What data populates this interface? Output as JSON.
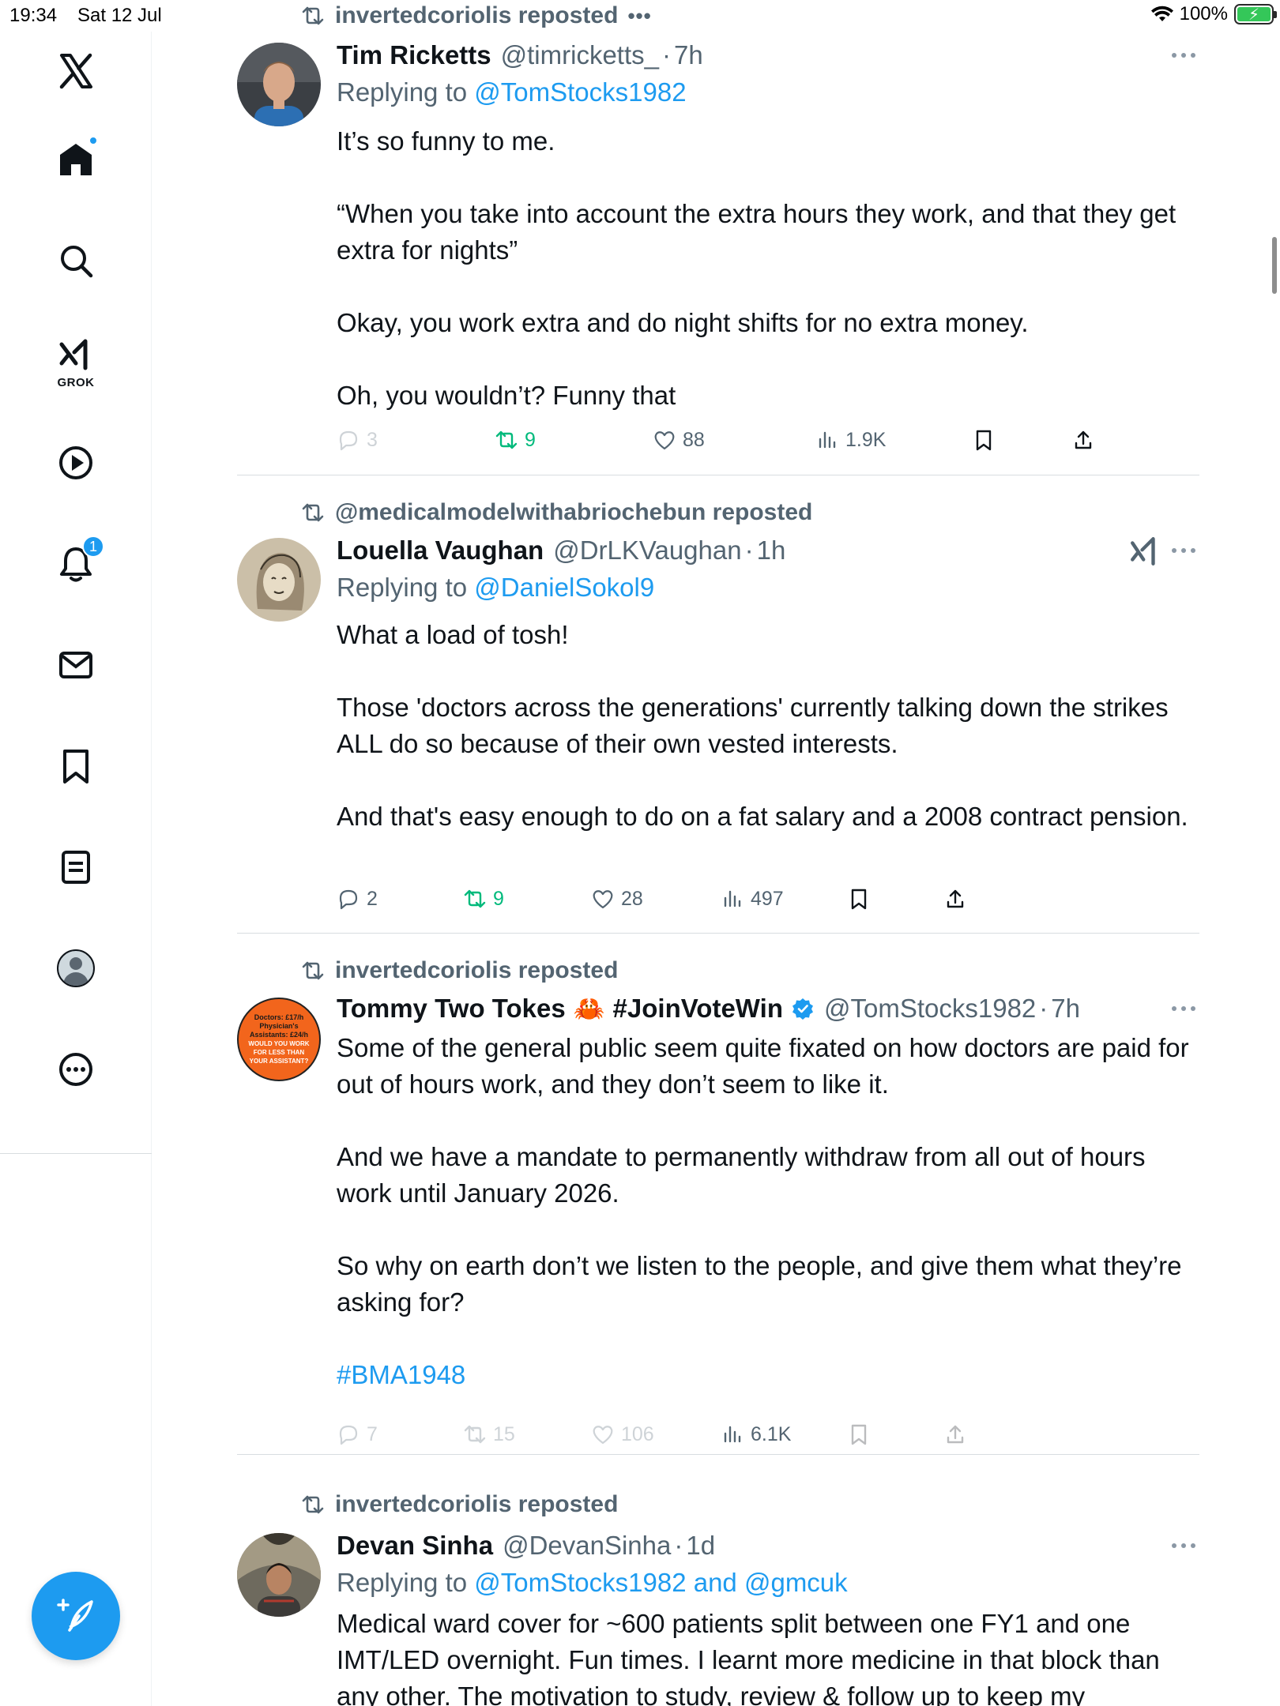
{
  "status_bar": {
    "time": "19:34",
    "date": "Sat 12 Jul",
    "battery": "100%"
  },
  "sidebar": {
    "grok_label": "GROK",
    "notifications_badge": "1"
  },
  "posts": [
    {
      "repost_by": "invertedcoriolis reposted",
      "name": "Tim Ricketts",
      "handle": "@timricketts_",
      "sep": "·",
      "time": "7h",
      "replying_prefix": "Replying to ",
      "replying_to": "@TomStocks1982",
      "paragraphs": [
        "It’s so funny to me.",
        "“When you take into account the extra hours they work, and that they get extra for nights”",
        "Okay, you work extra and do night shifts for no extra money.",
        "Oh, you wouldn’t? Funny that"
      ],
      "replies": "3",
      "reposts": "9",
      "likes": "88",
      "views": "1.9K"
    },
    {
      "repost_by": "@medicalmodelwithabriochebun reposted",
      "name": "Louella Vaughan",
      "handle": "@DrLKVaughan",
      "sep": "·",
      "time": "1h",
      "replying_prefix": "Replying to ",
      "replying_to": "@DanielSokol9",
      "paragraphs": [
        "What a load of tosh!",
        "Those 'doctors across the generations' currently talking down the strikes ALL do so because of their own vested interests.",
        "And that's easy enough to do on a fat salary and a 2008 contract pension."
      ],
      "replies": "2",
      "reposts": "9",
      "likes": "28",
      "views": "497"
    },
    {
      "repost_by": "invertedcoriolis reposted",
      "name": "Tommy Two Tokes",
      "name_tag": "#JoinVoteWin",
      "handle": "@TomStocks1982",
      "sep": "·",
      "time": "7h",
      "avatar_text": [
        "Doctors: £17/h",
        "Physician's",
        "Assistants: £24/h",
        "WOULD YOU WORK",
        "FOR LESS THAN",
        "YOUR ASSISTANT?"
      ],
      "paragraphs": [
        "Some of the general public seem quite fixated on how doctors are paid for out of hours work, and they don’t seem to like it.",
        "And we have a mandate to permanently withdraw from all out of hours work until January 2026.",
        "So why on earth don’t we listen to the people, and give them what they’re asking for?"
      ],
      "hashtag": "#BMA1948",
      "replies": "7",
      "reposts": "15",
      "likes": "106",
      "views": "6.1K"
    },
    {
      "repost_by": "invertedcoriolis reposted",
      "name": "Devan Sinha",
      "handle": "@DevanSinha",
      "sep": "·",
      "time": "1d",
      "replying_prefix": "Replying to ",
      "replying_to": "@TomStocks1982",
      "replying_and": " and ",
      "replying_to_2": "@gmcuk",
      "paragraphs": [
        "Medical ward cover for ~600 patients split between one FY1 and one IMT/LED overnight. Fun times. I learnt more medicine in that block than any other. The motivation to study, review & follow up to keep my"
      ]
    }
  ],
  "colors": {
    "accent": "#1d9bf0",
    "repost_green": "#00ba7c",
    "muted": "#536471",
    "text": "#0f1419"
  }
}
